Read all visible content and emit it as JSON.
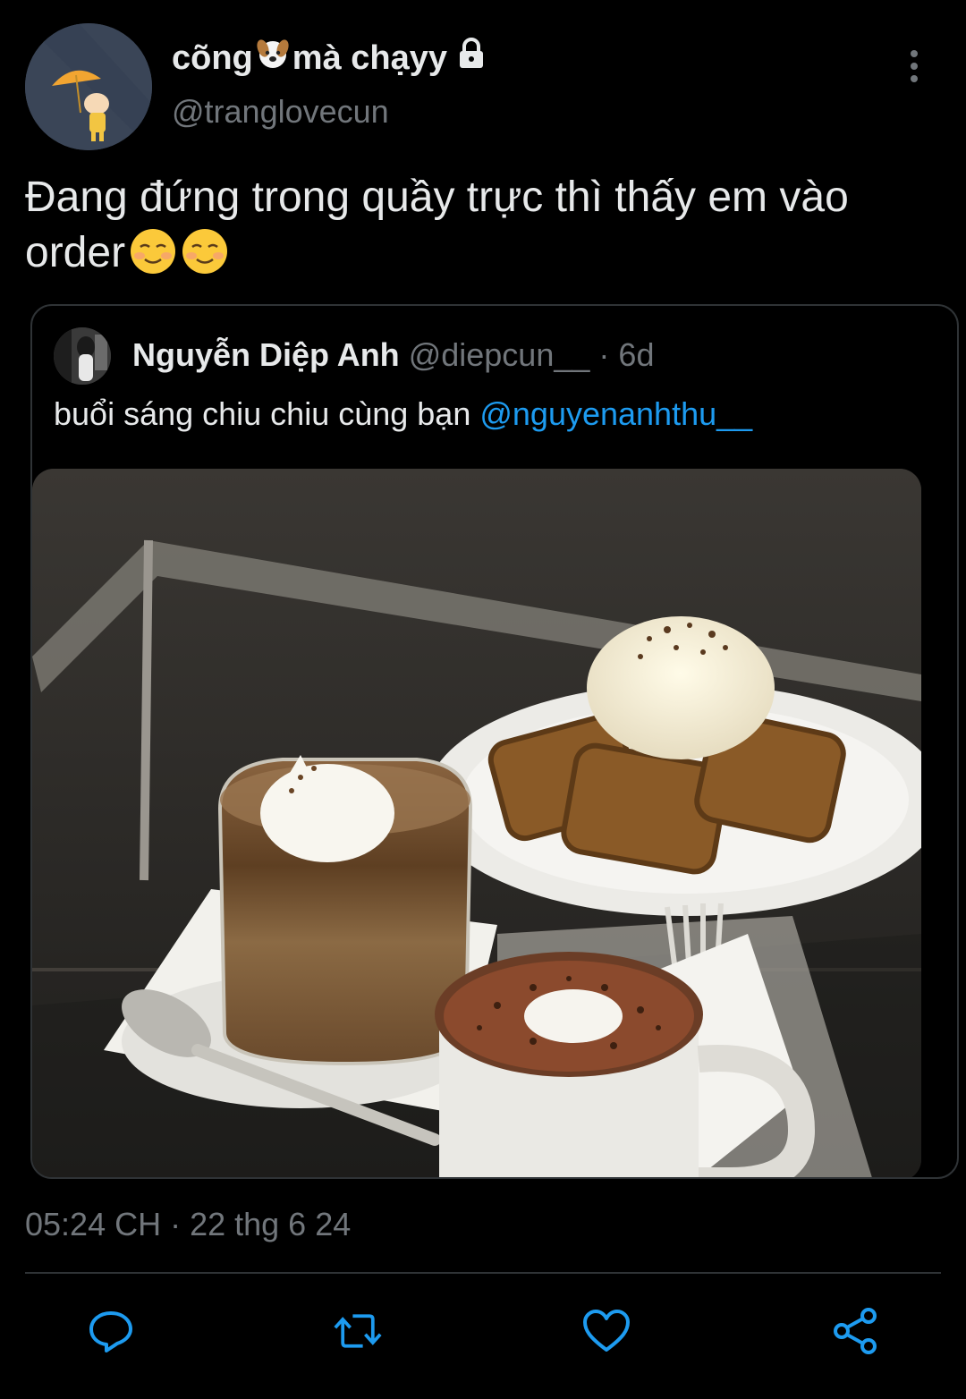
{
  "tweet": {
    "display_name": "cõng",
    "display_name_suffix": "mà chạyy",
    "handle": "@tranglovecun",
    "text": "Đang đứng trong quầy trực thì thấy em vào order",
    "text_emoji": "☺☺",
    "timestamp": "05:24 CH · 22 thg 6 24"
  },
  "quote": {
    "name": "Nguyễn Diệp Anh",
    "handle": "@diepcun__",
    "separator": "·",
    "age": "6d",
    "text": "buổi sáng chiu chiu cùng bạn ",
    "mention": "@nguyenanhthu__"
  },
  "icons": {
    "more": "more-vertical-icon",
    "lock": "lock-icon",
    "reply": "reply-icon",
    "retweet": "retweet-icon",
    "like": "heart-icon",
    "share": "share-icon"
  },
  "colors": {
    "background": "#000000",
    "text": "#e7e9ea",
    "muted": "#71767b",
    "link": "#1d9bf0",
    "border": "#2f3336"
  }
}
